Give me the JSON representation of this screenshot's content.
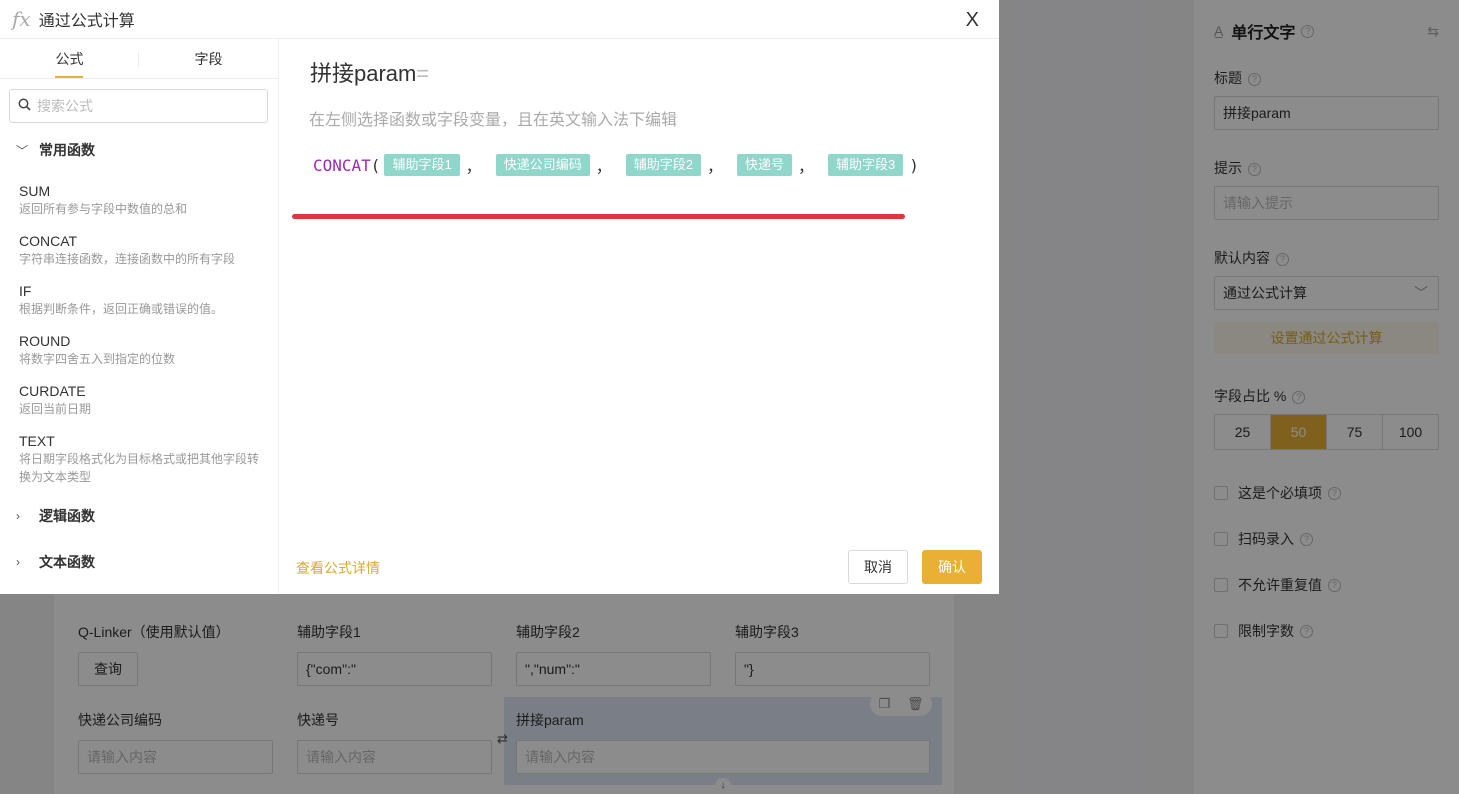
{
  "modal": {
    "title": "通过公式计算",
    "close_label": "X",
    "tabs": [
      {
        "label": "公式"
      },
      {
        "label": "字段"
      }
    ],
    "search_placeholder": "搜索公式",
    "groups": {
      "common": "常用函数",
      "logic": "逻辑函数",
      "text": "文本函数"
    },
    "functions": [
      {
        "name": "SUM",
        "desc": "返回所有参与字段中数值的总和"
      },
      {
        "name": "CONCAT",
        "desc": "字符串连接函数，连接函数中的所有字段"
      },
      {
        "name": "IF",
        "desc": "根据判断条件，返回正确或错误的值。"
      },
      {
        "name": "ROUND",
        "desc": "将数字四舍五入到指定的位数"
      },
      {
        "name": "CURDATE",
        "desc": "返回当前日期"
      },
      {
        "name": "TEXT",
        "desc": "将日期字段格式化为目标格式或把其他字段转换为文本类型"
      }
    ],
    "expression_title": "拼接param",
    "expression_eq": "=",
    "hint": "在左侧选择函数或字段变量，且在英文输入法下编辑",
    "formula": {
      "func": "CONCAT",
      "open": "(",
      "close": ")",
      "comma": "，",
      "args": [
        "辅助字段1",
        "快递公司编码",
        "辅助字段2",
        "快递号",
        "辅助字段3"
      ]
    },
    "detail_link": "查看公式详情",
    "cancel_label": "取消",
    "confirm_label": "确认"
  },
  "background": {
    "fields_row1": [
      {
        "label": "Q-Linker（使用默认值）",
        "button": "查询"
      },
      {
        "label": "辅助字段1",
        "value": "{\"com\":\""
      },
      {
        "label": "辅助字段2",
        "value": "\",\"num\":\""
      },
      {
        "label": "辅助字段3",
        "value": "\"}"
      }
    ],
    "fields_row2": [
      {
        "label": "快递公司编码",
        "placeholder": "请输入内容"
      },
      {
        "label": "快递号",
        "placeholder": "请输入内容"
      },
      {
        "label": "拼接param",
        "placeholder": "请输入内容"
      }
    ]
  },
  "panel": {
    "title": "单行文字",
    "title_label": "标题",
    "title_value": "拼接param",
    "hint_label": "提示",
    "hint_placeholder": "请输入提示",
    "default_label": "默认内容",
    "default_value": "通过公式计算",
    "formula_button": "设置通过公式计算",
    "width_label": "字段占比 %",
    "width_options": [
      "25",
      "50",
      "75",
      "100"
    ],
    "width_selected": "50",
    "checks": [
      "这是个必填项",
      "扫码录入",
      "不允许重复值",
      "限制字数"
    ]
  },
  "colors": {
    "accent": "#e9b035",
    "chip": "#8fd6cb",
    "keyword": "#9a2cae",
    "annotation": "#e2343a"
  }
}
